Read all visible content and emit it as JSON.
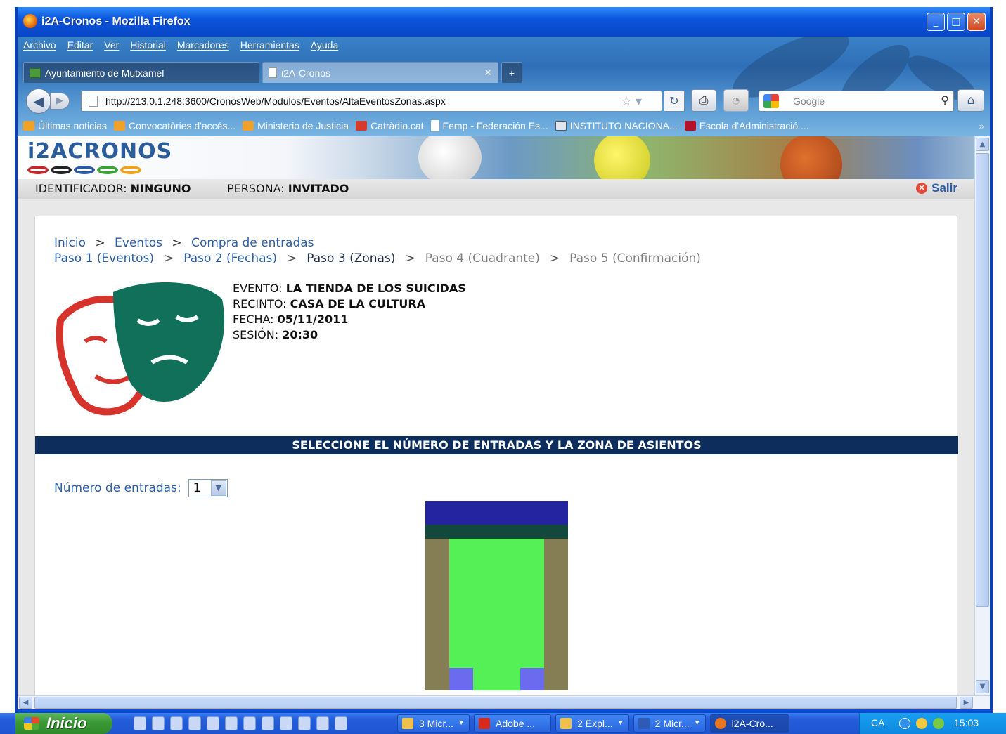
{
  "window": {
    "title": "i2A-Cronos - Mozilla Firefox",
    "controls": [
      "_",
      "□",
      "✕"
    ]
  },
  "menu": [
    "Archivo",
    "Editar",
    "Ver",
    "Historial",
    "Marcadores",
    "Herramientas",
    "Ayuda"
  ],
  "tabs": [
    {
      "label": "Ayuntamiento de Mutxamel",
      "active": false
    },
    {
      "label": "i2A-Cronos",
      "active": true
    }
  ],
  "nav": {
    "url": "http://213.0.1.248:3600/CronosWeb/Modulos/Eventos/AltaEventosZonas.aspx",
    "search_placeholder": "Google"
  },
  "bookmarks": [
    {
      "label": "Últimas noticias",
      "icon": "rss-icon"
    },
    {
      "label": "Convocatòries d'accés...",
      "icon": "rss-icon"
    },
    {
      "label": "Ministerio de Justicia",
      "icon": "rss-icon"
    },
    {
      "label": "Catràdio.cat",
      "icon": "catradio-icon"
    },
    {
      "label": "Femp - Federación Es...",
      "icon": "page-icon"
    },
    {
      "label": "INSTITUTO NACIONA...",
      "icon": "ine-icon"
    },
    {
      "label": "Escola d'Administració ...",
      "icon": "gencat-icon"
    }
  ],
  "site": {
    "logo": "i2ACRONOS",
    "identificador_label": "IDENTIFICADOR:",
    "identificador_value": "NINGUNO",
    "persona_label": "PERSONA:",
    "persona_value": "INVITADO",
    "salir": "Salir"
  },
  "breadcrumb": {
    "inicio": "Inicio",
    "eventos": "Eventos",
    "current": "Compra de entradas",
    "sep": ">"
  },
  "steps": [
    {
      "label": "Paso 1 (Eventos)",
      "state": "link"
    },
    {
      "label": "Paso 2 (Fechas)",
      "state": "link"
    },
    {
      "label": "Paso 3 (Zonas)",
      "state": "current"
    },
    {
      "label": "Paso 4 (Cuadrante)",
      "state": "disabled"
    },
    {
      "label": "Paso 5 (Confirmación)",
      "state": "disabled"
    }
  ],
  "event": {
    "evento_label": "EVENTO:",
    "evento_value": "LA TIENDA DE LOS SUICIDAS",
    "recinto_label": "RECINTO:",
    "recinto_value": "CASA DE LA CULTURA",
    "fecha_label": "FECHA:",
    "fecha_value": "05/11/2011",
    "sesion_label": "SESIÓN:",
    "sesion_value": "20:30"
  },
  "section_title": "SELECCIONE EL NÚMERO DE ENTRADAS Y LA ZONA DE ASIENTOS",
  "tickets": {
    "label": "Número de entradas:",
    "value": "1"
  },
  "seat_map_colors": {
    "stage": "#2424a0",
    "front": "#13483c",
    "sides": "#857e55",
    "main": "#55f055",
    "boxes": "#6b6bf0"
  },
  "taskbar": {
    "start": "Inicio",
    "tasks": [
      "3 Micr...",
      "Adobe ...",
      "2 Expl...",
      "2 Micr...",
      "i2A-Cro..."
    ],
    "lang": "CA",
    "time": "15:03"
  }
}
